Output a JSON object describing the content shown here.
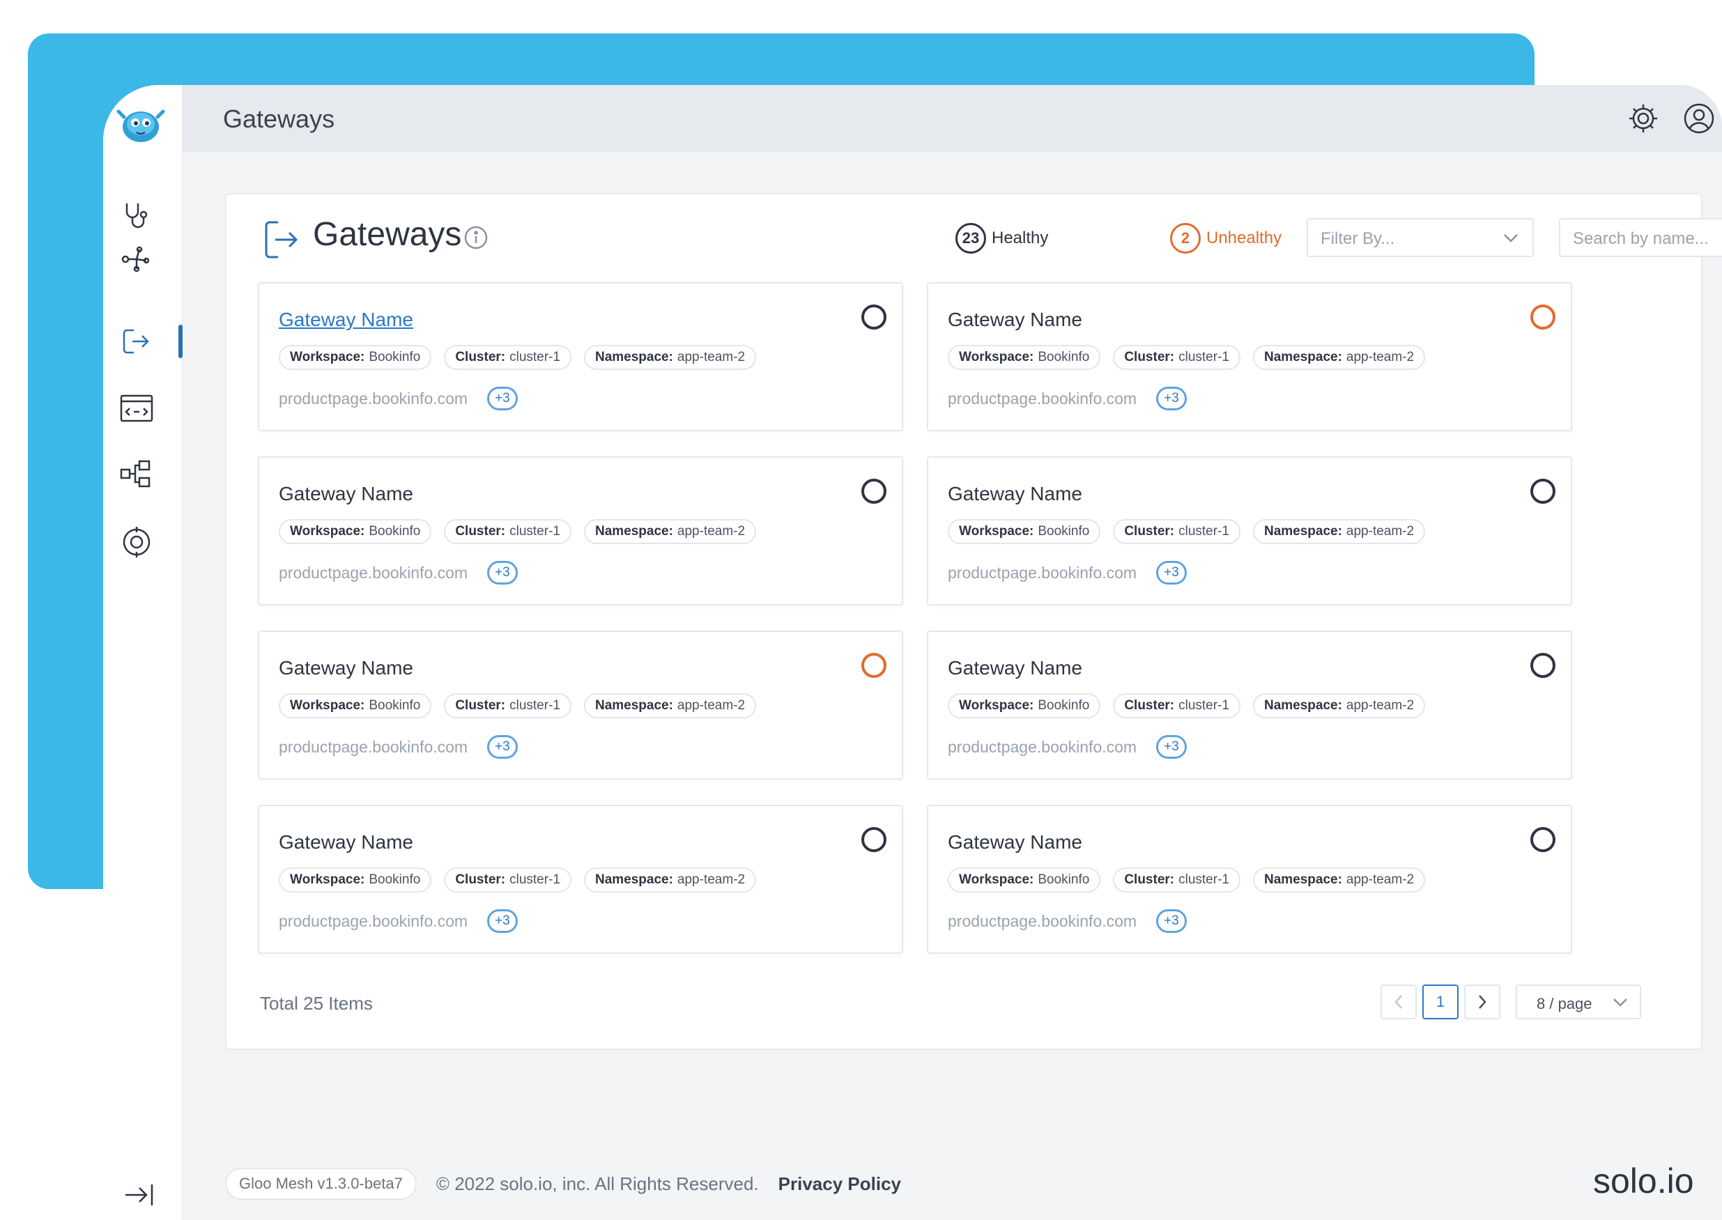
{
  "header": {
    "title": "Gateways"
  },
  "page": {
    "title": "Gateways",
    "healthy_count": "23",
    "healthy_label": "Healthy",
    "unhealthy_count": "2",
    "unhealthy_label": "Unhealthy",
    "filter_placeholder": "Filter By...",
    "search_placeholder": "Search by name..."
  },
  "gateways": [
    {
      "name": "Gateway Name",
      "status": "healthy",
      "workspace_label": "Workspace:",
      "workspace": "Bookinfo",
      "cluster_label": "Cluster:",
      "cluster": "cluster-1",
      "namespace_label": "Namespace:",
      "namespace": "app-team-2",
      "host": "productpage.bookinfo.com",
      "more": "+3"
    },
    {
      "name": "Gateway Name",
      "status": "unhealthy",
      "workspace_label": "Workspace:",
      "workspace": "Bookinfo",
      "cluster_label": "Cluster:",
      "cluster": "cluster-1",
      "namespace_label": "Namespace:",
      "namespace": "app-team-2",
      "host": "productpage.bookinfo.com",
      "more": "+3"
    },
    {
      "name": "Gateway Name",
      "status": "healthy",
      "workspace_label": "Workspace:",
      "workspace": "Bookinfo",
      "cluster_label": "Cluster:",
      "cluster": "cluster-1",
      "namespace_label": "Namespace:",
      "namespace": "app-team-2",
      "host": "productpage.bookinfo.com",
      "more": "+3"
    },
    {
      "name": "Gateway Name",
      "status": "healthy",
      "workspace_label": "Workspace:",
      "workspace": "Bookinfo",
      "cluster_label": "Cluster:",
      "cluster": "cluster-1",
      "namespace_label": "Namespace:",
      "namespace": "app-team-2",
      "host": "productpage.bookinfo.com",
      "more": "+3"
    },
    {
      "name": "Gateway Name",
      "status": "unhealthy",
      "workspace_label": "Workspace:",
      "workspace": "Bookinfo",
      "cluster_label": "Cluster:",
      "cluster": "cluster-1",
      "namespace_label": "Namespace:",
      "namespace": "app-team-2",
      "host": "productpage.bookinfo.com",
      "more": "+3"
    },
    {
      "name": "Gateway Name",
      "status": "healthy",
      "workspace_label": "Workspace:",
      "workspace": "Bookinfo",
      "cluster_label": "Cluster:",
      "cluster": "cluster-1",
      "namespace_label": "Namespace:",
      "namespace": "app-team-2",
      "host": "productpage.bookinfo.com",
      "more": "+3"
    },
    {
      "name": "Gateway Name",
      "status": "healthy",
      "workspace_label": "Workspace:",
      "workspace": "Bookinfo",
      "cluster_label": "Cluster:",
      "cluster": "cluster-1",
      "namespace_label": "Namespace:",
      "namespace": "app-team-2",
      "host": "productpage.bookinfo.com",
      "more": "+3"
    },
    {
      "name": "Gateway Name",
      "status": "healthy",
      "workspace_label": "Workspace:",
      "workspace": "Bookinfo",
      "cluster_label": "Cluster:",
      "cluster": "cluster-1",
      "namespace_label": "Namespace:",
      "namespace": "app-team-2",
      "host": "productpage.bookinfo.com",
      "more": "+3"
    }
  ],
  "pagination": {
    "total": "Total 25 Items",
    "current_page": "1",
    "per_page": "8 / page"
  },
  "footer": {
    "version": "Gloo Mesh v1.3.0-beta7",
    "copyright": "© 2022 solo.io, inc. All Rights Reserved.",
    "privacy": "Privacy Policy",
    "brand": "solo.io"
  },
  "colors": {
    "accent_blue": "#3bb7e8",
    "link": "#2a78c8",
    "unhealthy": "#e06c2e",
    "healthy": "#2e3440"
  },
  "icons": {
    "logo": "gloo-mascot-icon",
    "nav": [
      "stethoscope-icon",
      "graph-icon",
      "gateway-icon",
      "api-icon",
      "topology-icon",
      "policy-icon"
    ],
    "header": [
      "gear-icon",
      "user-icon",
      "help-icon"
    ]
  }
}
